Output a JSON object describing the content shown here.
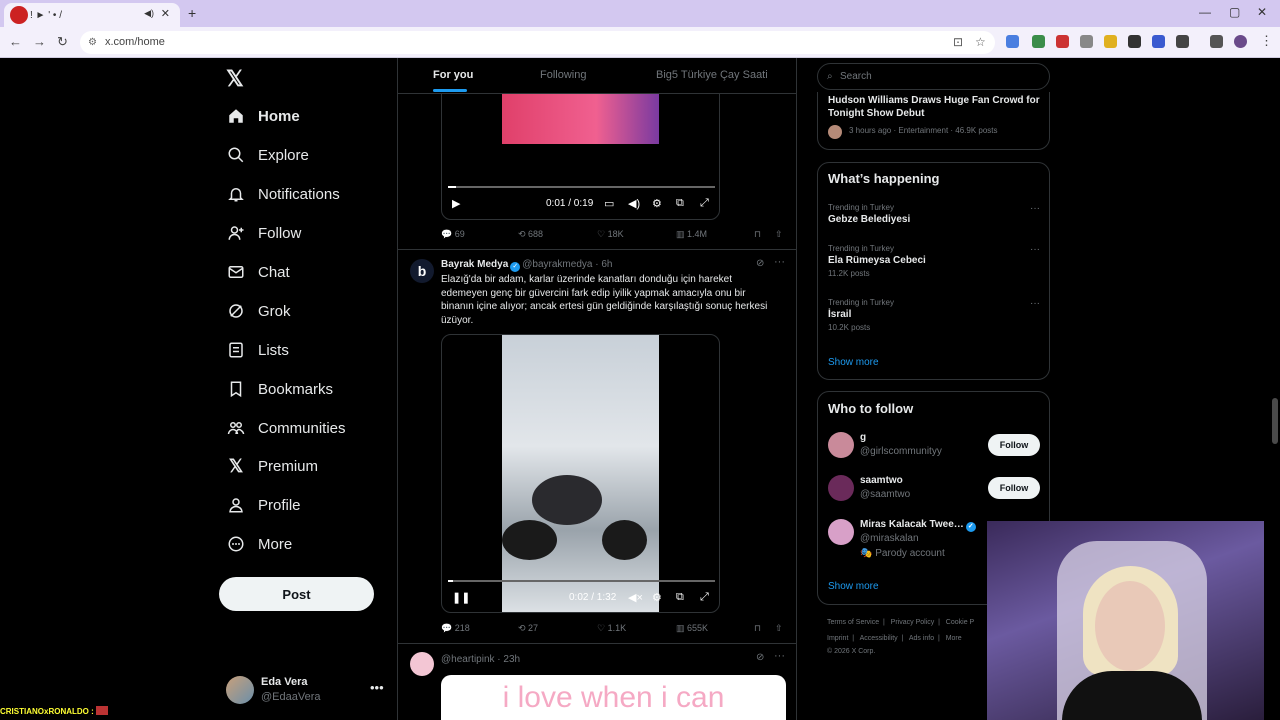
{
  "browser": {
    "tab_title": "! ► ' • /",
    "url": "x.com/home"
  },
  "nav": {
    "items": [
      {
        "label": "Home",
        "icon": "home-icon"
      },
      {
        "label": "Explore",
        "icon": "search-icon"
      },
      {
        "label": "Notifications",
        "icon": "bell-icon"
      },
      {
        "label": "Follow",
        "icon": "person-add-icon"
      },
      {
        "label": "Chat",
        "icon": "mail-icon"
      },
      {
        "label": "Grok",
        "icon": "grok-icon"
      },
      {
        "label": "Lists",
        "icon": "list-icon"
      },
      {
        "label": "Bookmarks",
        "icon": "bookmark-icon"
      },
      {
        "label": "Communities",
        "icon": "communities-icon"
      },
      {
        "label": "Premium",
        "icon": "x-icon"
      },
      {
        "label": "Profile",
        "icon": "person-icon"
      },
      {
        "label": "More",
        "icon": "more-icon"
      }
    ],
    "post_label": "Post",
    "user_name": "Eda Vera",
    "user_handle": "@EdaaVera"
  },
  "timeline": {
    "tabs": [
      "For you",
      "Following",
      "Big5 Türkiye Çay Saati"
    ],
    "tweet1": {
      "video_time": "0:01 / 0:19",
      "replies": "69",
      "reposts": "688",
      "likes": "18K",
      "views": "1.4M",
      "progress": 0.03
    },
    "tweet2": {
      "name": "Bayrak Medya",
      "handle": "@bayrakmedya · 6h",
      "text": "Elazığ'da bir adam, karlar üzerinde kanatları donduğu için hareket edemeyen genç bir güvercini fark edip iyilik yapmak amacıyla onu bir binanın içine alıyor; ancak ertesi gün geldiğinde karşılaştığı sonuç herkesi üzüyor.",
      "video_time": "0:02 / 1:32",
      "replies": "218",
      "reposts": "27",
      "likes": "1.1K",
      "views": "655K",
      "progress": 0.02
    },
    "tweet3": {
      "handle": "@heartipink · 23h",
      "image_text": "i love when i can"
    }
  },
  "right": {
    "search_placeholder": "Search",
    "news": {
      "title": "Hudson Williams Draws Huge Fan Crowd for Tonight Show Debut",
      "meta": "3 hours ago · Entertainment · 46.9K posts"
    },
    "happening_title": "What’s happening",
    "trends": [
      {
        "context": "Trending in Turkey",
        "title": "Gebze Belediyesi",
        "count": ""
      },
      {
        "context": "Trending in Turkey",
        "title": "Ela Rümeysa Cebeci",
        "count": "11.2K posts"
      },
      {
        "context": "Trending in Turkey",
        "title": "İsrail",
        "count": "10.2K posts"
      }
    ],
    "show_more": "Show more",
    "wtf_title": "Who to follow",
    "follows": [
      {
        "name": "ɡ",
        "handle": "@girlscommunityy",
        "button": "Follow"
      },
      {
        "name": "saamtwo",
        "handle": "@saamtwo",
        "button": "Follow"
      },
      {
        "name": "Miras Kalacak Twee…",
        "handle": "@miraskalan",
        "extra": "Parody account"
      }
    ],
    "footer": [
      "Terms of Service",
      "Privacy Policy",
      "Cookie P",
      "Imprint",
      "Accessibility",
      "Ads info",
      "More",
      "© 2026 X Corp."
    ]
  },
  "overlay": {
    "ticker": "CRISTIANOxRONALDO :"
  }
}
